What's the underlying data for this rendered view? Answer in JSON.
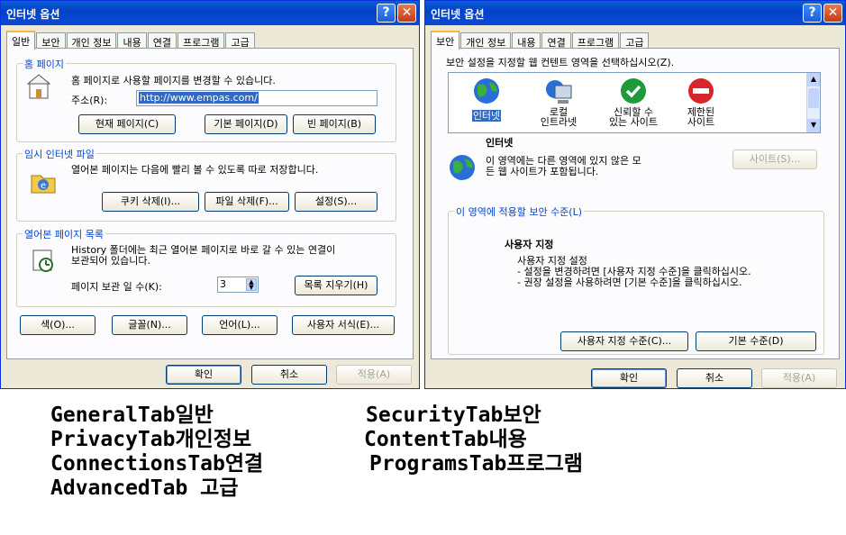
{
  "left_window": {
    "title": "인터넷 옵션",
    "tabs": [
      "일반",
      "보안",
      "개인 정보",
      "내용",
      "연결",
      "프로그램",
      "고급"
    ],
    "home_page": {
      "group_title": "홈 페이지",
      "desc": "홈 페이지로 사용할 페이지를 변경할 수 있습니다.",
      "address_label": "주소(R):",
      "address_value": "http://www.empas.com/",
      "btn_current": "현재 페이지(C)",
      "btn_default": "기본 페이지(D)",
      "btn_blank": "빈 페이지(B)"
    },
    "temp_files": {
      "group_title": "임시 인터넷 파일",
      "desc": "열어본 페이지는 다음에 빨리 볼 수 있도록 따로 저장합니다.",
      "btn_cookies": "쿠키 삭제(I)...",
      "btn_files": "파일 삭제(F)...",
      "btn_settings": "설정(S)..."
    },
    "history": {
      "group_title": "열어본 페이지 목록",
      "desc_line1": "History 폴더에는 최근 열어본 페이지로 바로 갈 수 있는 연결이",
      "desc_line2": "보관되어 있습니다.",
      "days_label": "페이지 보관 일 수(K):",
      "days_value": "3",
      "btn_clear": "목록 지우기(H)"
    },
    "bottom_buttons": [
      "색(O)...",
      "글꼴(N)...",
      "언어(L)...",
      "사용자 서식(E)..."
    ],
    "dialog_buttons": {
      "ok": "확인",
      "cancel": "취소",
      "apply": "적용(A)"
    }
  },
  "right_window": {
    "title": "인터넷 옵션",
    "tabs": [
      "보안",
      "개인 정보",
      "내용",
      "연결",
      "프로그램",
      "고급"
    ],
    "zone_prompt": "보안 설정을 지정할 웹 컨텐트 영역을 선택하십시오(Z).",
    "zones": [
      {
        "line1": "인터넷",
        "line2": "",
        "icon": "globe-icon"
      },
      {
        "line1": "로컬",
        "line2": "인트라넷",
        "icon": "computer-icon"
      },
      {
        "line1": "신뢰할 수",
        "line2": "있는 사이트",
        "icon": "check-icon"
      },
      {
        "line1": "제한된",
        "line2": "사이트",
        "icon": "restricted-icon"
      }
    ],
    "zone_name": "인터넷",
    "zone_desc_line1": "이 영역에는 다른 영역에 있지 않은 모",
    "zone_desc_line2": "든 웹 사이트가 포함됩니다.",
    "btn_sites": "사이트(S)...",
    "level_group_title": "이 영역에 적용할 보안 수준(L)",
    "level_title": "사용자 지정",
    "level_line1": "사용자 지정 설정",
    "level_line2": "- 설정을 변경하려면 [사용자 지정 수준]을 클릭하십시오.",
    "level_line3": "- 권장 설정을 사용하려면 [기본 수준]을 클릭하십시오.",
    "btn_custom_level": "사용자 지정 수준(C)...",
    "btn_default_level": "기본 수준(D)",
    "dialog_buttons": {
      "ok": "확인",
      "cancel": "취소",
      "apply": "적용(A)"
    }
  },
  "legend": {
    "general": "GeneralTab일반",
    "security": "SecurityTab보안",
    "privacy": "PrivacyTab개인정보",
    "content": "ContentTab내용",
    "connections": "ConnectionsTab연결",
    "programs": "ProgramsTab프로그램",
    "advanced": "AdvancedTab 고급"
  },
  "colors": {
    "titlebar": "#0a4bd6",
    "dialog_bg": "#ece9d8",
    "panel_bg": "#fcfcfe",
    "group_title": "#0046d5",
    "selection": "#316ac5"
  }
}
